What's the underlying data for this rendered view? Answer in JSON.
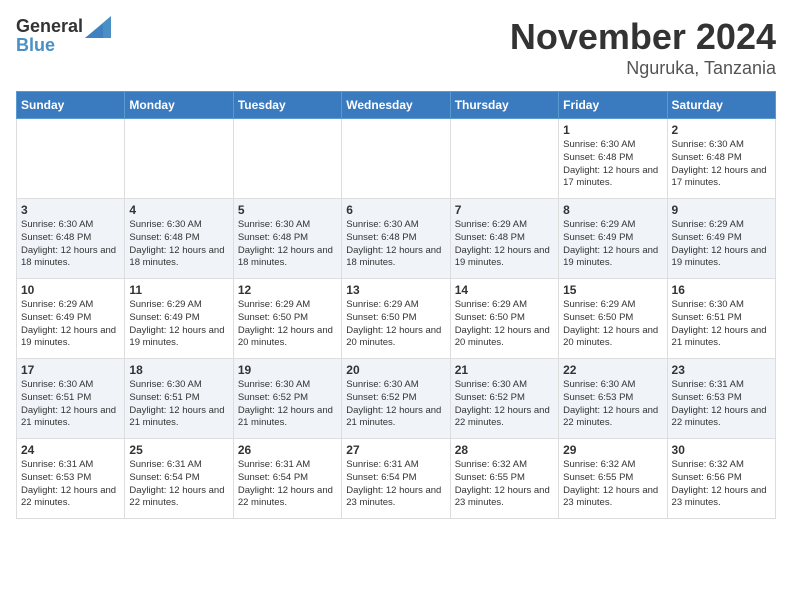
{
  "logo": {
    "general": "General",
    "blue": "Blue"
  },
  "title": {
    "month": "November 2024",
    "location": "Nguruka, Tanzania"
  },
  "headers": [
    "Sunday",
    "Monday",
    "Tuesday",
    "Wednesday",
    "Thursday",
    "Friday",
    "Saturday"
  ],
  "weeks": [
    [
      {
        "day": "",
        "info": ""
      },
      {
        "day": "",
        "info": ""
      },
      {
        "day": "",
        "info": ""
      },
      {
        "day": "",
        "info": ""
      },
      {
        "day": "",
        "info": ""
      },
      {
        "day": "1",
        "info": "Sunrise: 6:30 AM\nSunset: 6:48 PM\nDaylight: 12 hours and 17 minutes."
      },
      {
        "day": "2",
        "info": "Sunrise: 6:30 AM\nSunset: 6:48 PM\nDaylight: 12 hours and 17 minutes."
      }
    ],
    [
      {
        "day": "3",
        "info": "Sunrise: 6:30 AM\nSunset: 6:48 PM\nDaylight: 12 hours and 18 minutes."
      },
      {
        "day": "4",
        "info": "Sunrise: 6:30 AM\nSunset: 6:48 PM\nDaylight: 12 hours and 18 minutes."
      },
      {
        "day": "5",
        "info": "Sunrise: 6:30 AM\nSunset: 6:48 PM\nDaylight: 12 hours and 18 minutes."
      },
      {
        "day": "6",
        "info": "Sunrise: 6:30 AM\nSunset: 6:48 PM\nDaylight: 12 hours and 18 minutes."
      },
      {
        "day": "7",
        "info": "Sunrise: 6:29 AM\nSunset: 6:48 PM\nDaylight: 12 hours and 19 minutes."
      },
      {
        "day": "8",
        "info": "Sunrise: 6:29 AM\nSunset: 6:49 PM\nDaylight: 12 hours and 19 minutes."
      },
      {
        "day": "9",
        "info": "Sunrise: 6:29 AM\nSunset: 6:49 PM\nDaylight: 12 hours and 19 minutes."
      }
    ],
    [
      {
        "day": "10",
        "info": "Sunrise: 6:29 AM\nSunset: 6:49 PM\nDaylight: 12 hours and 19 minutes."
      },
      {
        "day": "11",
        "info": "Sunrise: 6:29 AM\nSunset: 6:49 PM\nDaylight: 12 hours and 19 minutes."
      },
      {
        "day": "12",
        "info": "Sunrise: 6:29 AM\nSunset: 6:50 PM\nDaylight: 12 hours and 20 minutes."
      },
      {
        "day": "13",
        "info": "Sunrise: 6:29 AM\nSunset: 6:50 PM\nDaylight: 12 hours and 20 minutes."
      },
      {
        "day": "14",
        "info": "Sunrise: 6:29 AM\nSunset: 6:50 PM\nDaylight: 12 hours and 20 minutes."
      },
      {
        "day": "15",
        "info": "Sunrise: 6:29 AM\nSunset: 6:50 PM\nDaylight: 12 hours and 20 minutes."
      },
      {
        "day": "16",
        "info": "Sunrise: 6:30 AM\nSunset: 6:51 PM\nDaylight: 12 hours and 21 minutes."
      }
    ],
    [
      {
        "day": "17",
        "info": "Sunrise: 6:30 AM\nSunset: 6:51 PM\nDaylight: 12 hours and 21 minutes."
      },
      {
        "day": "18",
        "info": "Sunrise: 6:30 AM\nSunset: 6:51 PM\nDaylight: 12 hours and 21 minutes."
      },
      {
        "day": "19",
        "info": "Sunrise: 6:30 AM\nSunset: 6:52 PM\nDaylight: 12 hours and 21 minutes."
      },
      {
        "day": "20",
        "info": "Sunrise: 6:30 AM\nSunset: 6:52 PM\nDaylight: 12 hours and 21 minutes."
      },
      {
        "day": "21",
        "info": "Sunrise: 6:30 AM\nSunset: 6:52 PM\nDaylight: 12 hours and 22 minutes."
      },
      {
        "day": "22",
        "info": "Sunrise: 6:30 AM\nSunset: 6:53 PM\nDaylight: 12 hours and 22 minutes."
      },
      {
        "day": "23",
        "info": "Sunrise: 6:31 AM\nSunset: 6:53 PM\nDaylight: 12 hours and 22 minutes."
      }
    ],
    [
      {
        "day": "24",
        "info": "Sunrise: 6:31 AM\nSunset: 6:53 PM\nDaylight: 12 hours and 22 minutes."
      },
      {
        "day": "25",
        "info": "Sunrise: 6:31 AM\nSunset: 6:54 PM\nDaylight: 12 hours and 22 minutes."
      },
      {
        "day": "26",
        "info": "Sunrise: 6:31 AM\nSunset: 6:54 PM\nDaylight: 12 hours and 22 minutes."
      },
      {
        "day": "27",
        "info": "Sunrise: 6:31 AM\nSunset: 6:54 PM\nDaylight: 12 hours and 23 minutes."
      },
      {
        "day": "28",
        "info": "Sunrise: 6:32 AM\nSunset: 6:55 PM\nDaylight: 12 hours and 23 minutes."
      },
      {
        "day": "29",
        "info": "Sunrise: 6:32 AM\nSunset: 6:55 PM\nDaylight: 12 hours and 23 minutes."
      },
      {
        "day": "30",
        "info": "Sunrise: 6:32 AM\nSunset: 6:56 PM\nDaylight: 12 hours and 23 minutes."
      }
    ]
  ]
}
